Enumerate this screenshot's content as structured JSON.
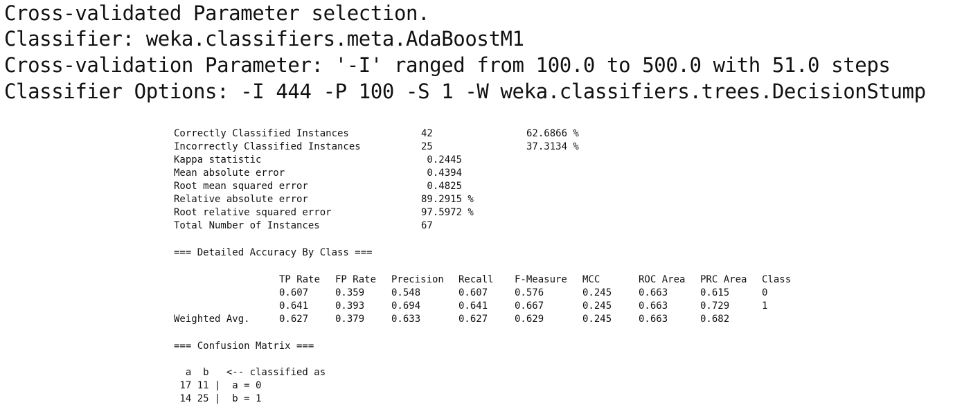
{
  "header": {
    "line1": "Cross-validated Parameter selection.",
    "line2": "Classifier: weka.classifiers.meta.AdaBoostM1",
    "line3": "Cross-validation Parameter: '-I' ranged from 100.0 to 500.0 with 51.0 steps",
    "line4": "Classifier Options: -I 444 -P 100 -S 1 -W weka.classifiers.trees.DecisionStump"
  },
  "summary": [
    {
      "label": "Correctly Classified Instances",
      "value": "42",
      "extra": "62.6866 %"
    },
    {
      "label": "Incorrectly Classified Instances",
      "value": "25",
      "extra": "37.3134 %"
    },
    {
      "label": "Kappa statistic",
      "value": " 0.2445",
      "extra": ""
    },
    {
      "label": "Mean absolute error",
      "value": " 0.4394",
      "extra": ""
    },
    {
      "label": "Root mean squared error",
      "value": " 0.4825",
      "extra": ""
    },
    {
      "label": "Relative absolute error",
      "value": "89.2915 %",
      "extra": ""
    },
    {
      "label": "Root relative squared error",
      "value": "97.5972 %",
      "extra": ""
    },
    {
      "label": "Total Number of Instances",
      "value": "67",
      "extra": ""
    }
  ],
  "detailed_heading": "=== Detailed Accuracy By Class ===",
  "accuracy_table": {
    "columns": [
      "TP Rate",
      "FP Rate",
      "Precision",
      "Recall",
      "F-Measure",
      "MCC",
      "ROC Area",
      "PRC Area",
      "Class"
    ],
    "rows": [
      {
        "label": "",
        "cells": [
          "0.607",
          "0.359",
          "0.548",
          "0.607",
          "0.576",
          "0.245",
          "0.663",
          "0.615",
          "0"
        ]
      },
      {
        "label": "",
        "cells": [
          "0.641",
          "0.393",
          "0.694",
          "0.641",
          "0.667",
          "0.245",
          "0.663",
          "0.729",
          "1"
        ]
      },
      {
        "label": "Weighted Avg.",
        "cells": [
          "0.627",
          "0.379",
          "0.633",
          "0.627",
          "0.629",
          "0.245",
          "0.663",
          "0.682",
          ""
        ]
      }
    ]
  },
  "confusion_heading": "=== Confusion Matrix ===",
  "confusion": {
    "header": "  a  b   <-- classified as",
    "rows": [
      " 17 11 |  a = 0",
      " 14 25 |  b = 1"
    ]
  }
}
